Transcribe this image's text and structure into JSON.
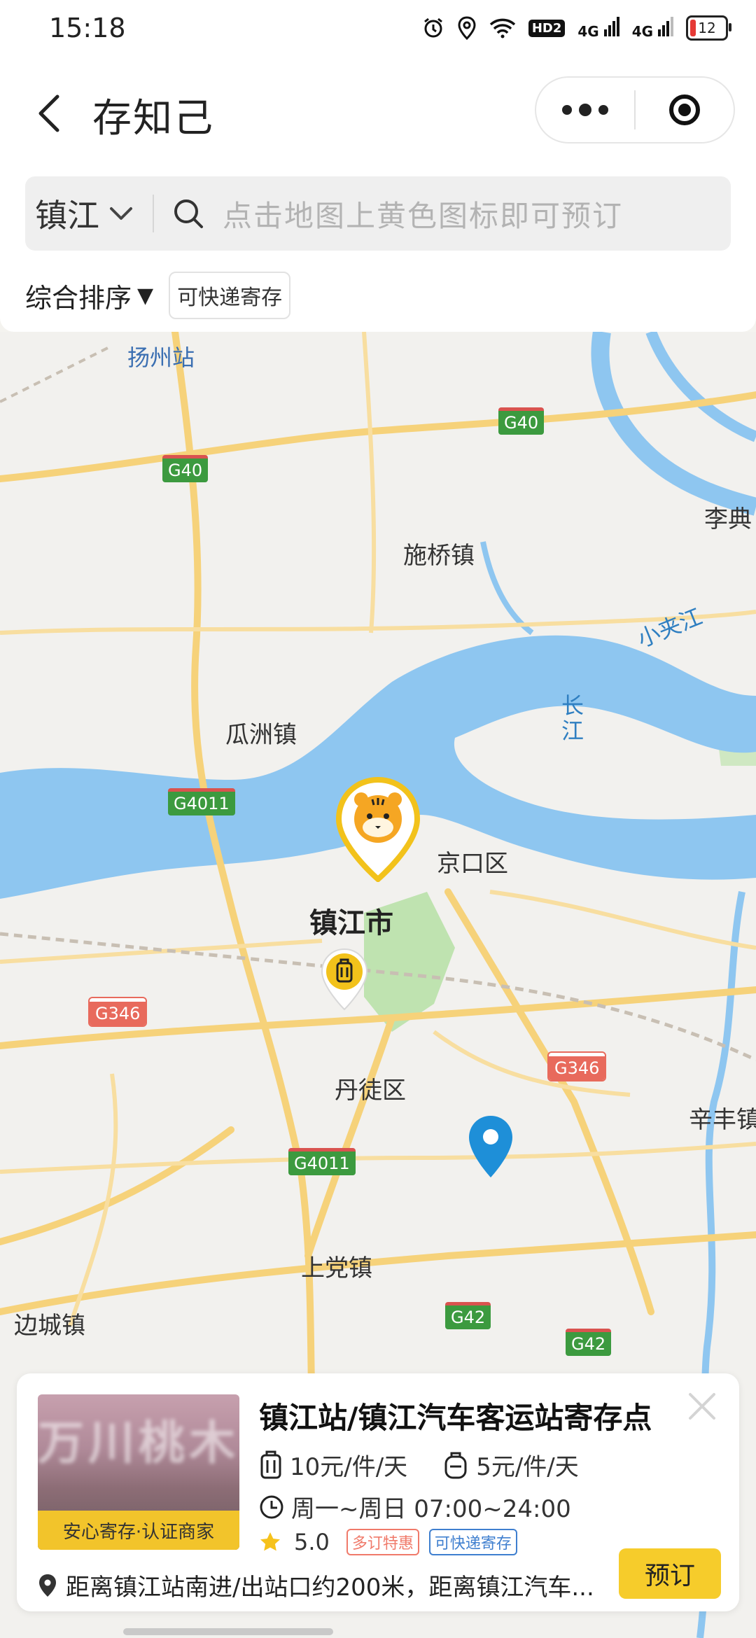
{
  "status_bar": {
    "time": "15:18",
    "hd_label": "HD2",
    "signal1_label": "4G",
    "signal2_label": "4G",
    "battery_level": "12"
  },
  "nav": {
    "title": "存知己"
  },
  "search": {
    "city": "镇江",
    "placeholder": "点击地图上黄色图标即可预订"
  },
  "filters": {
    "sort_label": "综合排序",
    "sort_arrow": "▼",
    "express_tag": "可快递寄存"
  },
  "map": {
    "labels": {
      "yangzhou_station": "扬州站",
      "shiqiao": "施桥镇",
      "lidian": "李典",
      "xiaojiajiang": "小夹江",
      "changjiang": "长\n江",
      "guazhou": "瓜洲镇",
      "jingkou": "京口区",
      "zhenjiang_city": "镇江市",
      "dantu": "丹徒区",
      "xinfeng": "辛丰镇",
      "shangdang": "上党镇",
      "biancheng": "边城镇"
    },
    "shields": {
      "g40_a": "G40",
      "g40_b": "G40",
      "g4011_a": "G4011",
      "g4011_b": "G4011",
      "g346_a": "G346",
      "g346_b": "G346",
      "g42_a": "G42",
      "g42_b": "G42"
    }
  },
  "card": {
    "thumb_banner": "安心寄存·认证商家",
    "name": "镇江站/镇江汽车客运站寄存点",
    "price_luggage": "10元/件/天",
    "price_bag": "5元/件/天",
    "hours": "周一~周日 07:00~24:00",
    "rating": "5.0",
    "badge_discount": "多订特惠",
    "badge_express": "可快递寄存",
    "address": "距离镇江站南进/出站口约200米，距离镇江汽车...",
    "book_label": "预订"
  }
}
